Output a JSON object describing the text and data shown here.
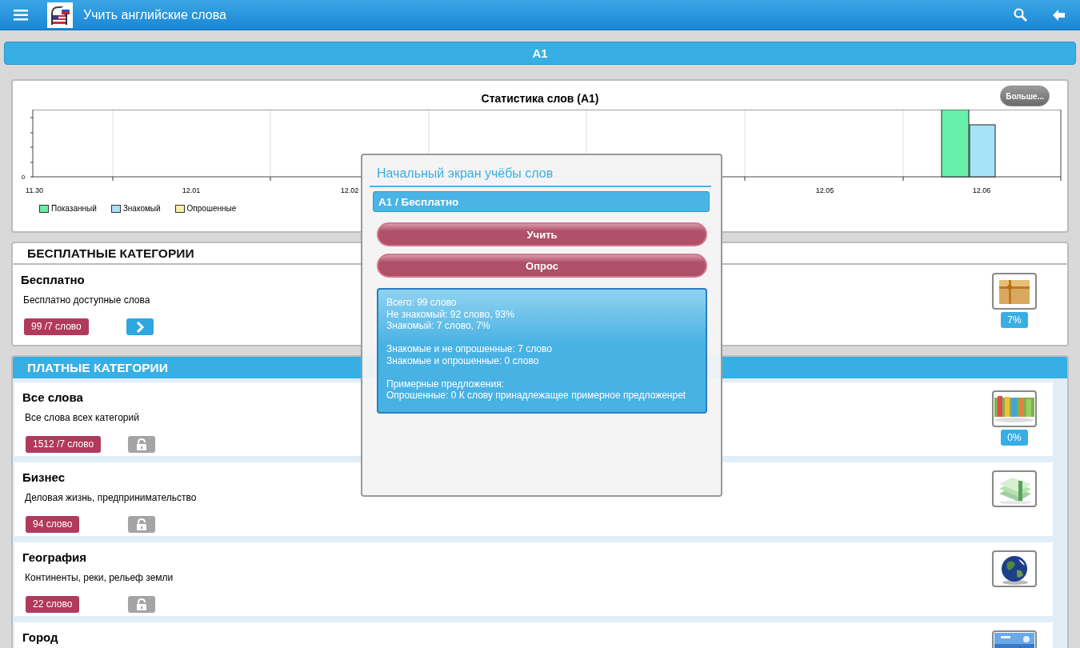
{
  "app_bar": {
    "title": "Учить английские слова"
  },
  "level_bar": {
    "label": "A1"
  },
  "stats_chart": {
    "title": "Статистика слов (A1)",
    "more_button": "Больше...",
    "y_zero": "0",
    "x_labels": [
      "11.30",
      "12.01",
      "12.02",
      "12.05",
      "12.06"
    ],
    "legend": [
      {
        "label": "Показанный",
        "color": "#66f0aa"
      },
      {
        "label": "Знакомый",
        "color": "#a6e2f8"
      },
      {
        "label": "Опрошенные",
        "color": "#f5f3a0"
      }
    ]
  },
  "free_section": {
    "title": "БЕСПЛАТНЫЕ КАТЕГОРИИ",
    "items": [
      {
        "name": "Бесплатно",
        "description": "Бесплатно доступные слова",
        "count": "99 /7 слово",
        "locked": false,
        "percent": "7%"
      }
    ]
  },
  "paid_section": {
    "title": "ПЛАТНЫЕ КАТЕГОРИИ",
    "items": [
      {
        "name": "Все слова",
        "description": "Все слова всех категорий",
        "count": "1512 /7 слово",
        "locked": true,
        "percent": "0%"
      },
      {
        "name": "Бизнес",
        "description": "Деловая жизнь, предпринимательство",
        "count": "94 слово",
        "locked": true
      },
      {
        "name": "География",
        "description": "Континенты, реки, рельеф земли",
        "count": "22 слово",
        "locked": true
      },
      {
        "name": "Город"
      }
    ]
  },
  "dialog": {
    "title": "Начальный экран учёбы слов",
    "subtitle": "A1 / Бесплатно",
    "buttons": [
      "Учить",
      "Опрос"
    ],
    "stats_groups": [
      [
        "Всего: 99 слово",
        "Не знакомый: 92 слово, 93%",
        "Знакомый: 7 слово, 7%"
      ],
      [
        "Знакомые и не опрошенные: 7 слово",
        "Знакомые и опрошенные: 0 слово"
      ],
      [
        "Примерные предложения:",
        "Опрошенные: 0 К слову принадлежащее примерное предложенрet"
      ]
    ]
  }
}
